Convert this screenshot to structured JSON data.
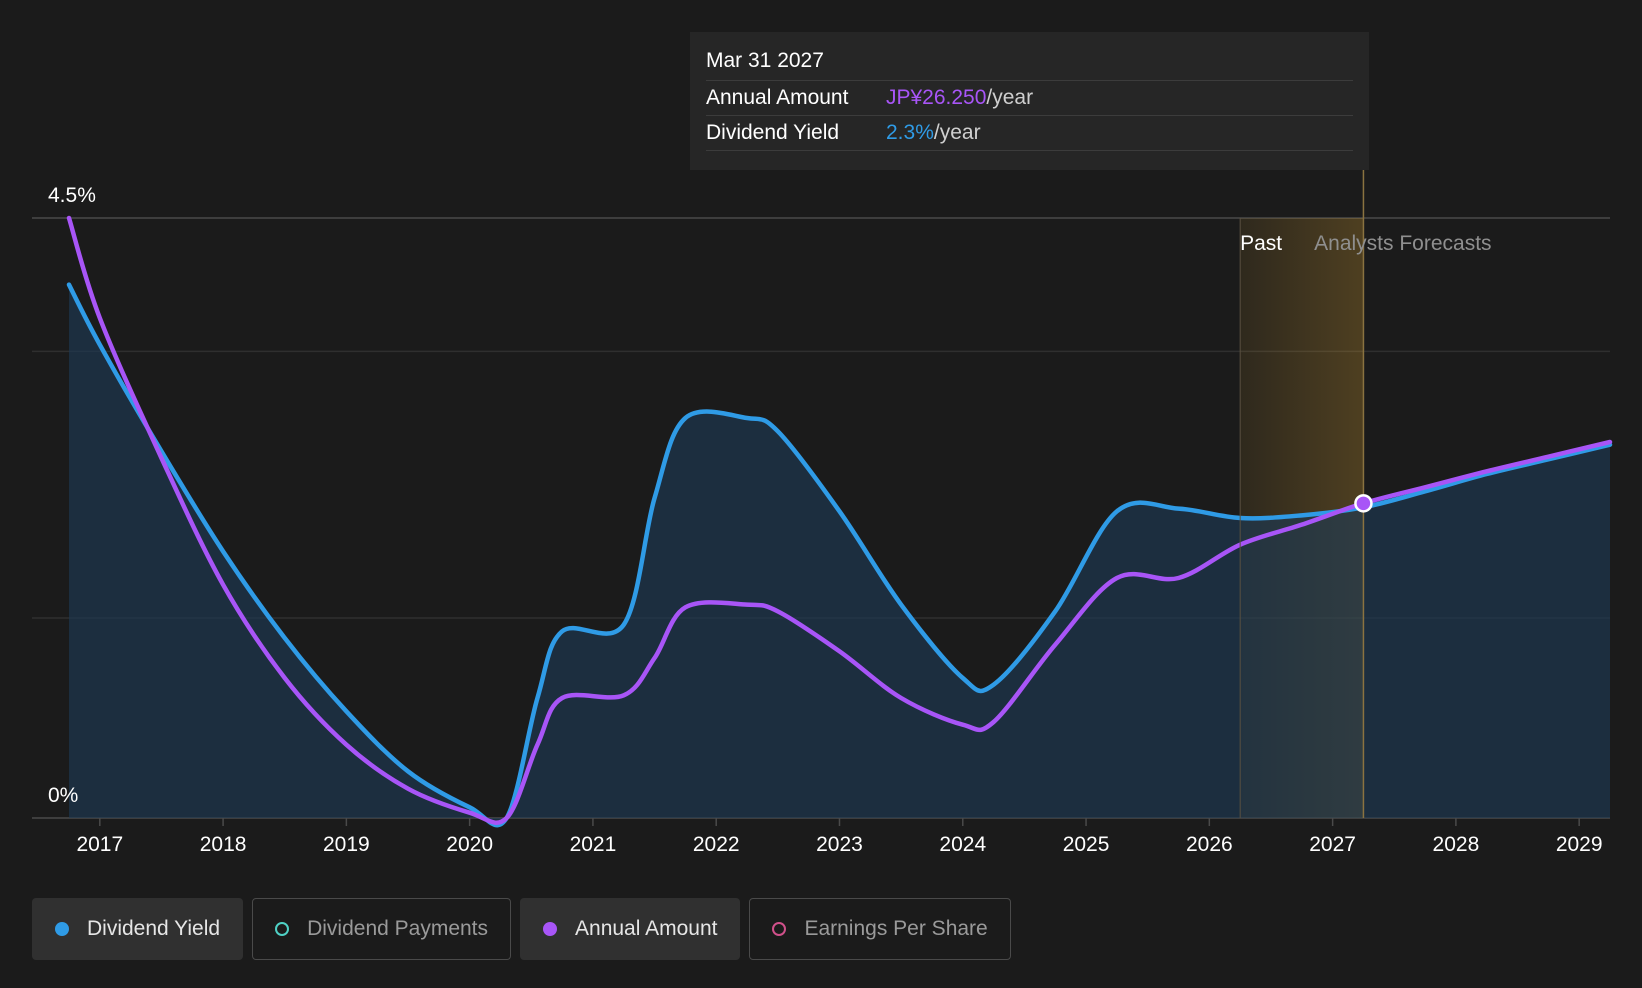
{
  "tooltip": {
    "date": "Mar 31 2027",
    "rows": [
      {
        "label": "Annual Amount",
        "value": "JP¥26.250",
        "unit": "/year"
      },
      {
        "label": "Dividend Yield",
        "value": "2.3%",
        "unit": "/year"
      }
    ]
  },
  "legend": [
    {
      "label": "Dividend Yield",
      "color": "#2f9be6",
      "active": true,
      "filled": true
    },
    {
      "label": "Dividend Payments",
      "color": "#4fd1c5",
      "active": false,
      "filled": false
    },
    {
      "label": "Annual Amount",
      "color": "#a855f7",
      "active": true,
      "filled": true
    },
    {
      "label": "Earnings Per Share",
      "color": "#d0508a",
      "active": false,
      "filled": false
    }
  ],
  "chart_data": {
    "type": "line",
    "y_tick_labels": [
      "4.5%",
      "0%"
    ],
    "ylim": [
      0,
      4.5
    ],
    "xlim": [
      2016.45,
      2029.25
    ],
    "x_ticks": [
      2017,
      2018,
      2019,
      2020,
      2021,
      2022,
      2023,
      2024,
      2025,
      2026,
      2027,
      2028,
      2029
    ],
    "x_tick_labels": [
      "2017",
      "2018",
      "2019",
      "2020",
      "2021",
      "2022",
      "2023",
      "2024",
      "2025",
      "2026",
      "2027",
      "2028",
      "2029"
    ],
    "past_label": "Past",
    "forecast_label": "Analysts Forecasts",
    "forecast_start": 2026.25,
    "hover_x": 2027.25,
    "series": [
      {
        "name": "Dividend Yield",
        "color": "#2f9be6",
        "area": true,
        "points": [
          [
            2016.75,
            4.0
          ],
          [
            2017.0,
            3.55
          ],
          [
            2017.5,
            2.75
          ],
          [
            2018.0,
            2.0
          ],
          [
            2018.5,
            1.35
          ],
          [
            2019.0,
            0.8
          ],
          [
            2019.5,
            0.35
          ],
          [
            2020.0,
            0.08
          ],
          [
            2020.3,
            0.0
          ],
          [
            2020.55,
            0.9
          ],
          [
            2020.75,
            1.4
          ],
          [
            2021.25,
            1.45
          ],
          [
            2021.5,
            2.4
          ],
          [
            2021.75,
            3.0
          ],
          [
            2022.25,
            3.0
          ],
          [
            2022.5,
            2.9
          ],
          [
            2023.0,
            2.3
          ],
          [
            2023.5,
            1.6
          ],
          [
            2024.0,
            1.05
          ],
          [
            2024.25,
            1.0
          ],
          [
            2024.75,
            1.55
          ],
          [
            2025.25,
            2.3
          ],
          [
            2025.75,
            2.32
          ],
          [
            2026.25,
            2.25
          ],
          [
            2026.75,
            2.27
          ],
          [
            2027.25,
            2.33
          ],
          [
            2027.75,
            2.45
          ],
          [
            2028.25,
            2.58
          ],
          [
            2028.75,
            2.69
          ],
          [
            2029.25,
            2.8
          ]
        ]
      },
      {
        "name": "Annual Amount",
        "color": "#a855f7",
        "area": false,
        "points": [
          [
            2016.75,
            4.5
          ],
          [
            2017.0,
            3.75
          ],
          [
            2017.5,
            2.7
          ],
          [
            2018.0,
            1.75
          ],
          [
            2018.5,
            1.05
          ],
          [
            2019.0,
            0.55
          ],
          [
            2019.5,
            0.22
          ],
          [
            2020.0,
            0.04
          ],
          [
            2020.3,
            0.0
          ],
          [
            2020.55,
            0.55
          ],
          [
            2020.75,
            0.9
          ],
          [
            2021.25,
            0.92
          ],
          [
            2021.5,
            1.2
          ],
          [
            2021.75,
            1.58
          ],
          [
            2022.25,
            1.6
          ],
          [
            2022.5,
            1.55
          ],
          [
            2023.0,
            1.25
          ],
          [
            2023.5,
            0.9
          ],
          [
            2024.0,
            0.7
          ],
          [
            2024.25,
            0.72
          ],
          [
            2024.75,
            1.3
          ],
          [
            2025.25,
            1.8
          ],
          [
            2025.75,
            1.8
          ],
          [
            2026.25,
            2.05
          ],
          [
            2026.75,
            2.2
          ],
          [
            2027.25,
            2.36
          ],
          [
            2027.75,
            2.48
          ],
          [
            2028.25,
            2.6
          ],
          [
            2028.75,
            2.71
          ],
          [
            2029.25,
            2.82
          ]
        ]
      }
    ]
  }
}
